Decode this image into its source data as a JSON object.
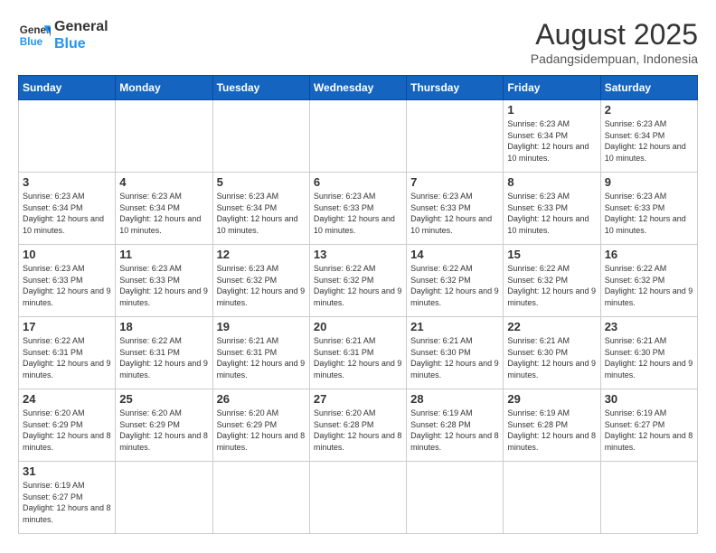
{
  "header": {
    "logo_general": "General",
    "logo_blue": "Blue",
    "month_year": "August 2025",
    "location": "Padangsidempuan, Indonesia"
  },
  "weekdays": [
    "Sunday",
    "Monday",
    "Tuesday",
    "Wednesday",
    "Thursday",
    "Friday",
    "Saturday"
  ],
  "weeks": [
    [
      {
        "day": "",
        "info": ""
      },
      {
        "day": "",
        "info": ""
      },
      {
        "day": "",
        "info": ""
      },
      {
        "day": "",
        "info": ""
      },
      {
        "day": "",
        "info": ""
      },
      {
        "day": "1",
        "info": "Sunrise: 6:23 AM\nSunset: 6:34 PM\nDaylight: 12 hours and 10 minutes."
      },
      {
        "day": "2",
        "info": "Sunrise: 6:23 AM\nSunset: 6:34 PM\nDaylight: 12 hours and 10 minutes."
      }
    ],
    [
      {
        "day": "3",
        "info": "Sunrise: 6:23 AM\nSunset: 6:34 PM\nDaylight: 12 hours and 10 minutes."
      },
      {
        "day": "4",
        "info": "Sunrise: 6:23 AM\nSunset: 6:34 PM\nDaylight: 12 hours and 10 minutes."
      },
      {
        "day": "5",
        "info": "Sunrise: 6:23 AM\nSunset: 6:34 PM\nDaylight: 12 hours and 10 minutes."
      },
      {
        "day": "6",
        "info": "Sunrise: 6:23 AM\nSunset: 6:33 PM\nDaylight: 12 hours and 10 minutes."
      },
      {
        "day": "7",
        "info": "Sunrise: 6:23 AM\nSunset: 6:33 PM\nDaylight: 12 hours and 10 minutes."
      },
      {
        "day": "8",
        "info": "Sunrise: 6:23 AM\nSunset: 6:33 PM\nDaylight: 12 hours and 10 minutes."
      },
      {
        "day": "9",
        "info": "Sunrise: 6:23 AM\nSunset: 6:33 PM\nDaylight: 12 hours and 10 minutes."
      }
    ],
    [
      {
        "day": "10",
        "info": "Sunrise: 6:23 AM\nSunset: 6:33 PM\nDaylight: 12 hours and 9 minutes."
      },
      {
        "day": "11",
        "info": "Sunrise: 6:23 AM\nSunset: 6:33 PM\nDaylight: 12 hours and 9 minutes."
      },
      {
        "day": "12",
        "info": "Sunrise: 6:23 AM\nSunset: 6:32 PM\nDaylight: 12 hours and 9 minutes."
      },
      {
        "day": "13",
        "info": "Sunrise: 6:22 AM\nSunset: 6:32 PM\nDaylight: 12 hours and 9 minutes."
      },
      {
        "day": "14",
        "info": "Sunrise: 6:22 AM\nSunset: 6:32 PM\nDaylight: 12 hours and 9 minutes."
      },
      {
        "day": "15",
        "info": "Sunrise: 6:22 AM\nSunset: 6:32 PM\nDaylight: 12 hours and 9 minutes."
      },
      {
        "day": "16",
        "info": "Sunrise: 6:22 AM\nSunset: 6:32 PM\nDaylight: 12 hours and 9 minutes."
      }
    ],
    [
      {
        "day": "17",
        "info": "Sunrise: 6:22 AM\nSunset: 6:31 PM\nDaylight: 12 hours and 9 minutes."
      },
      {
        "day": "18",
        "info": "Sunrise: 6:22 AM\nSunset: 6:31 PM\nDaylight: 12 hours and 9 minutes."
      },
      {
        "day": "19",
        "info": "Sunrise: 6:21 AM\nSunset: 6:31 PM\nDaylight: 12 hours and 9 minutes."
      },
      {
        "day": "20",
        "info": "Sunrise: 6:21 AM\nSunset: 6:31 PM\nDaylight: 12 hours and 9 minutes."
      },
      {
        "day": "21",
        "info": "Sunrise: 6:21 AM\nSunset: 6:30 PM\nDaylight: 12 hours and 9 minutes."
      },
      {
        "day": "22",
        "info": "Sunrise: 6:21 AM\nSunset: 6:30 PM\nDaylight: 12 hours and 9 minutes."
      },
      {
        "day": "23",
        "info": "Sunrise: 6:21 AM\nSunset: 6:30 PM\nDaylight: 12 hours and 9 minutes."
      }
    ],
    [
      {
        "day": "24",
        "info": "Sunrise: 6:20 AM\nSunset: 6:29 PM\nDaylight: 12 hours and 8 minutes."
      },
      {
        "day": "25",
        "info": "Sunrise: 6:20 AM\nSunset: 6:29 PM\nDaylight: 12 hours and 8 minutes."
      },
      {
        "day": "26",
        "info": "Sunrise: 6:20 AM\nSunset: 6:29 PM\nDaylight: 12 hours and 8 minutes."
      },
      {
        "day": "27",
        "info": "Sunrise: 6:20 AM\nSunset: 6:28 PM\nDaylight: 12 hours and 8 minutes."
      },
      {
        "day": "28",
        "info": "Sunrise: 6:19 AM\nSunset: 6:28 PM\nDaylight: 12 hours and 8 minutes."
      },
      {
        "day": "29",
        "info": "Sunrise: 6:19 AM\nSunset: 6:28 PM\nDaylight: 12 hours and 8 minutes."
      },
      {
        "day": "30",
        "info": "Sunrise: 6:19 AM\nSunset: 6:27 PM\nDaylight: 12 hours and 8 minutes."
      }
    ],
    [
      {
        "day": "31",
        "info": "Sunrise: 6:19 AM\nSunset: 6:27 PM\nDaylight: 12 hours and 8 minutes."
      },
      {
        "day": "",
        "info": ""
      },
      {
        "day": "",
        "info": ""
      },
      {
        "day": "",
        "info": ""
      },
      {
        "day": "",
        "info": ""
      },
      {
        "day": "",
        "info": ""
      },
      {
        "day": "",
        "info": ""
      }
    ]
  ]
}
